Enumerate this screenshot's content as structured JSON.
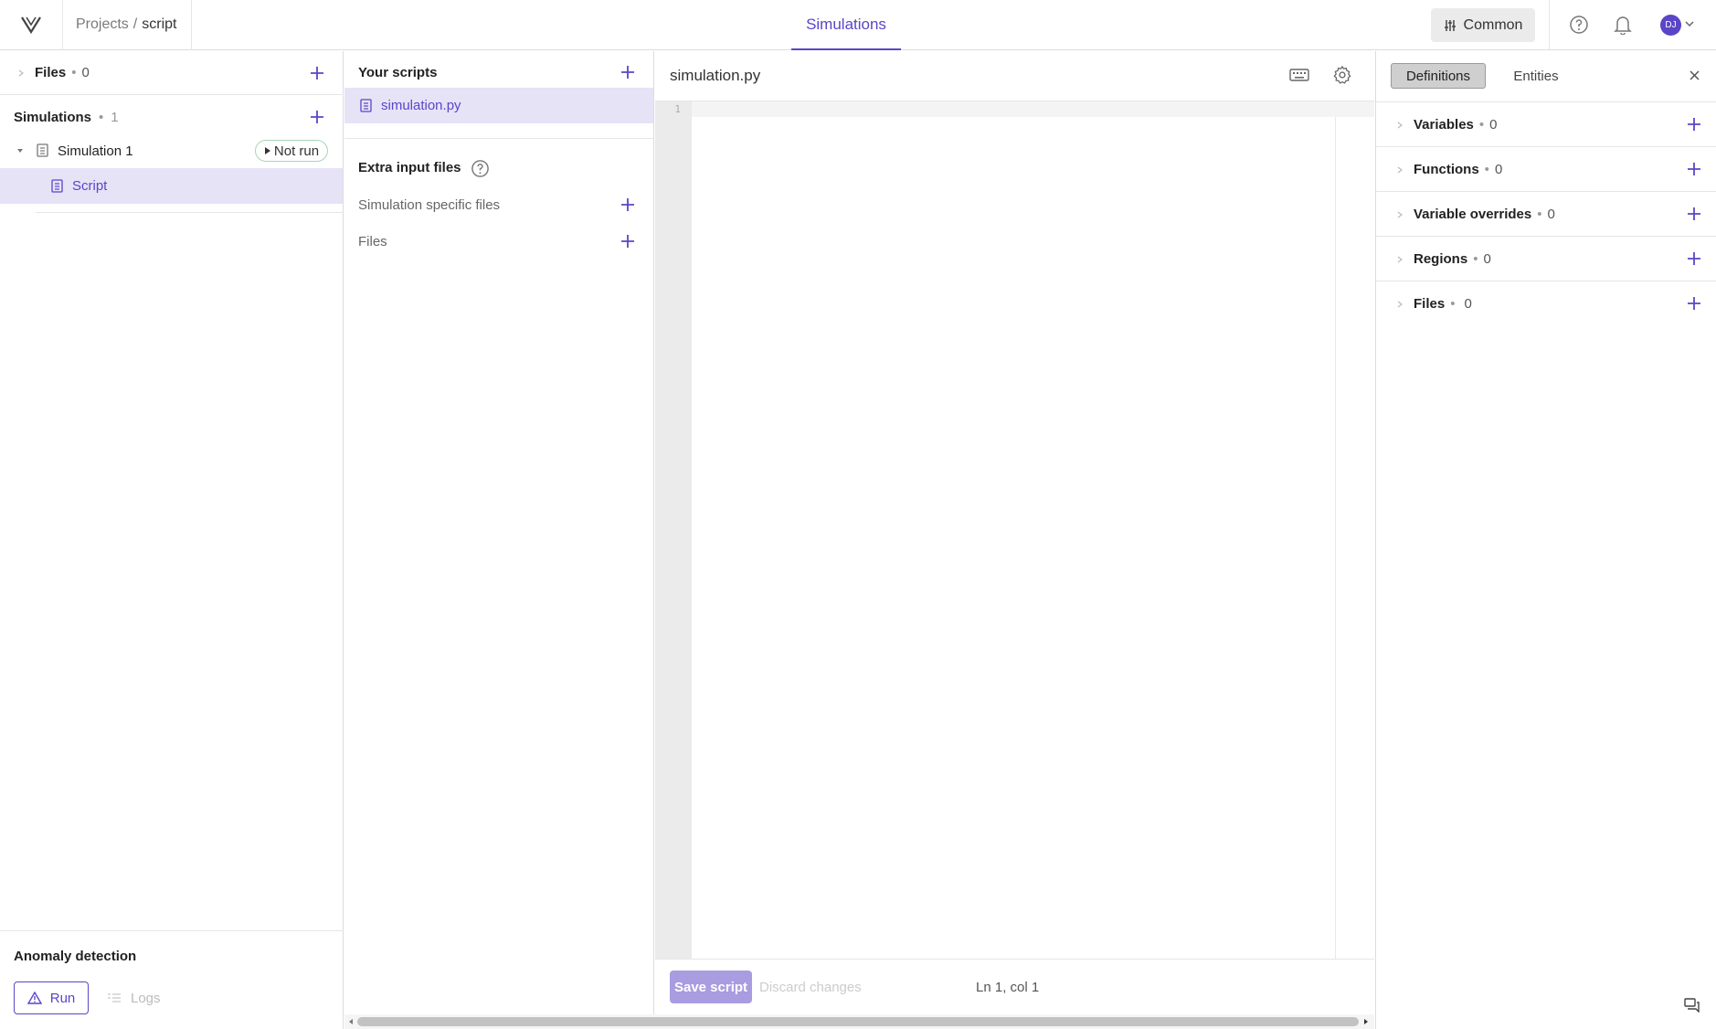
{
  "header": {
    "breadcrumb_root": "Projects",
    "breadcrumb_sep": "/",
    "breadcrumb_current": "script",
    "active_tab": "Simulations",
    "common_button": "Common",
    "avatar_initials": "DJ"
  },
  "left": {
    "files_label": "Files",
    "files_dot": "•",
    "files_count": "0",
    "simulations_label": "Simulations",
    "simulations_dot": "•",
    "simulations_count": "1",
    "simulation_name": "Simulation 1",
    "status_badge": "Not run",
    "script_label": "Script",
    "anomaly_title": "Anomaly detection",
    "run_button": "Run",
    "logs_button": "Logs"
  },
  "middle": {
    "your_scripts": "Your scripts",
    "script_file": "simulation.py",
    "extra_input_files": "Extra input files",
    "simulation_specific_files": "Simulation specific files",
    "files": "Files"
  },
  "editor": {
    "filename": "simulation.py",
    "line_number": "1",
    "save_button": "Save script",
    "discard_button": "Discard changes",
    "cursor_position": "Ln 1, col 1"
  },
  "right": {
    "tab_definitions": "Definitions",
    "tab_entities": "Entities",
    "sections": [
      {
        "label": "Variables",
        "dot": "•",
        "count": "0"
      },
      {
        "label": "Functions",
        "dot": "•",
        "count": "0"
      },
      {
        "label": "Variable overrides",
        "dot": "•",
        "count": "0"
      },
      {
        "label": "Regions",
        "dot": "•",
        "count": "0"
      },
      {
        "label": "Files",
        "dot": "•",
        "count": "0"
      }
    ]
  },
  "colors": {
    "accent": "#5b45c7",
    "selected_bg": "#e6e3f7",
    "save_disabled": "#a99ce0"
  }
}
